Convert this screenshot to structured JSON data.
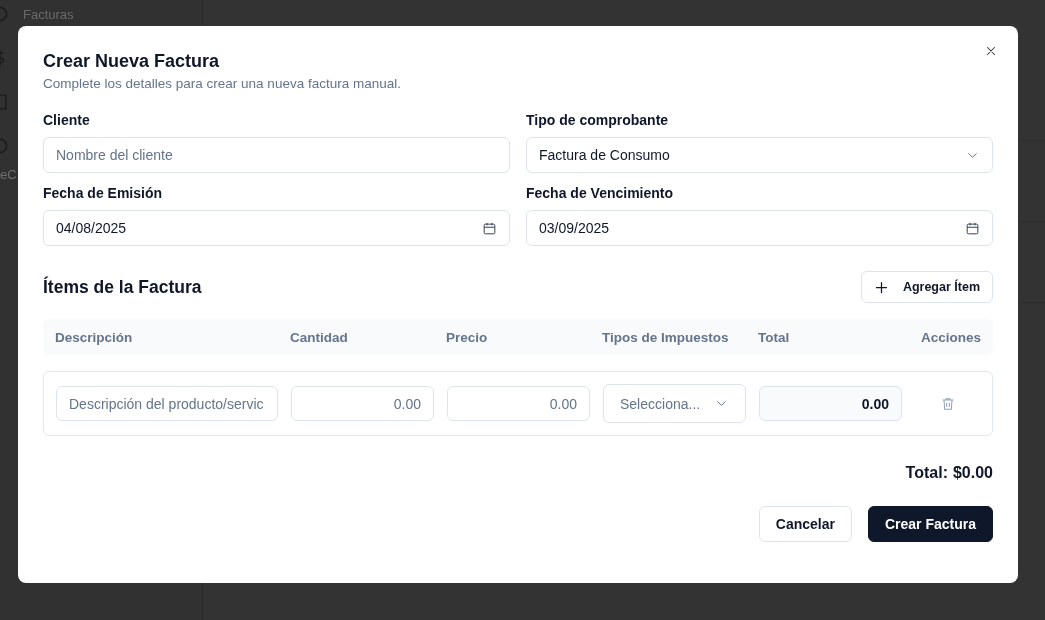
{
  "background": {
    "sidebar": [
      {
        "label": "Facturas",
        "kind": "item"
      },
      {
        "label": "eC",
        "kind": "partial"
      }
    ]
  },
  "dialog": {
    "title": "Crear Nueva Factura",
    "description": "Complete los detalles para crear una nueva factura manual.",
    "fields": [
      {
        "label": "Cliente",
        "kind": "text",
        "placeholder": "Nombre del cliente"
      },
      {
        "label": "Tipo de comprobante",
        "kind": "select",
        "value": "Factura de Consumo"
      },
      {
        "label": "Fecha de Emisión",
        "kind": "date",
        "value": "04/08/2025"
      },
      {
        "label": "Fecha de Vencimiento",
        "kind": "date",
        "value": "03/09/2025"
      }
    ],
    "items_section": {
      "title": "Ítems de la Factura",
      "add_button": "Agregar Ítem",
      "columns": [
        "Descripción",
        "Cantidad",
        "Precio",
        "Tipos de Impuestos",
        "Total",
        "Acciones"
      ],
      "rows": [
        {
          "description": {
            "placeholder": "Descripción del producto/servic"
          },
          "quantity": {
            "placeholder": "0.00"
          },
          "price": {
            "placeholder": "0.00"
          },
          "tax": {
            "placeholder": "Selecciona..."
          },
          "total": "0.00"
        }
      ]
    },
    "total_label": "Total:",
    "total_value": "$0.00",
    "buttons": [
      {
        "label": "Cancelar",
        "kind": "secondary"
      },
      {
        "label": "Crear Factura",
        "kind": "primary"
      }
    ]
  }
}
